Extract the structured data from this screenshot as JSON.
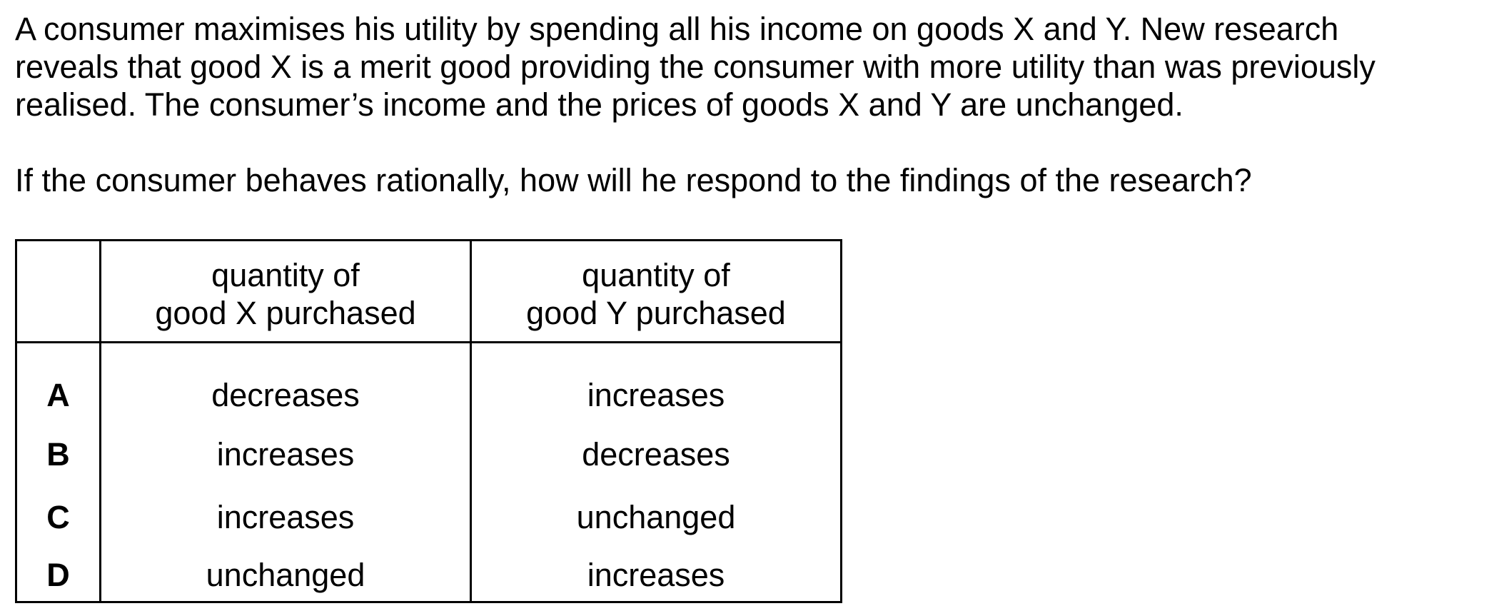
{
  "question": {
    "stem_lines": [
      "A consumer maximises his utility by spending all his income on goods X and Y. New research",
      "reveals that good X is a merit good providing the consumer with more utility than was previously",
      "realised. The consumer’s income and the prices of goods X and Y are unchanged."
    ],
    "prompt": "If the consumer behaves rationally, how will he respond to the findings of the research?"
  },
  "table": {
    "headers": {
      "letter": "",
      "x_line1": "quantity of",
      "x_line2": "good X purchased",
      "y_line1": "quantity of",
      "y_line2": "good Y purchased"
    },
    "rows": [
      {
        "letter": "A",
        "x": "decreases",
        "y": "increases"
      },
      {
        "letter": "B",
        "x": "increases",
        "y": "decreases"
      },
      {
        "letter": "C",
        "x": "increases",
        "y": "unchanged"
      },
      {
        "letter": "D",
        "x": "unchanged",
        "y": "increases"
      }
    ]
  }
}
